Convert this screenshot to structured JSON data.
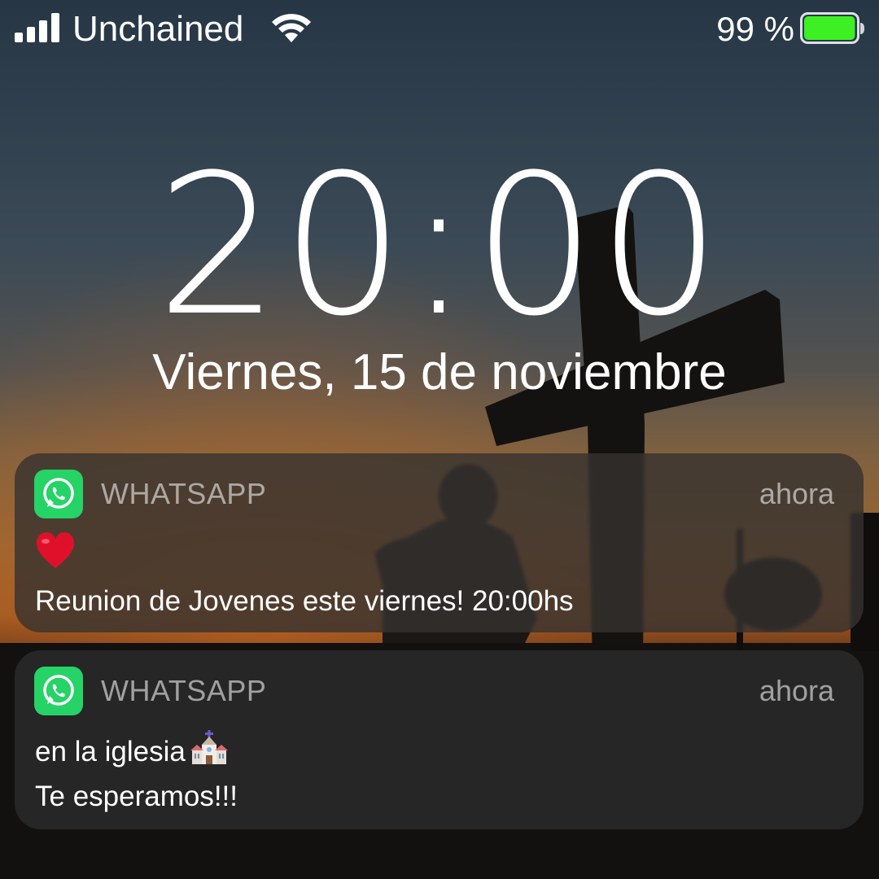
{
  "status_bar": {
    "carrier": "Unchained",
    "battery_percent": "99 %",
    "battery_level": 0.99,
    "battery_color": "#3df024"
  },
  "lock_screen": {
    "time": "20:00",
    "date": "Viernes, 15 de noviembre"
  },
  "notifications": [
    {
      "app": "WHATSAPP",
      "time": "ahora",
      "icon": "whatsapp-icon",
      "lines": [
        "❤️",
        "Reunion de Jovenes este viernes! 20:00hs"
      ]
    },
    {
      "app": "WHATSAPP",
      "time": "ahora",
      "icon": "whatsapp-icon",
      "lines": [
        "en la iglesia",
        "Te esperamos!!!"
      ]
    }
  ],
  "colors": {
    "whatsapp_green": "#25d366",
    "sky_top": "#2a3848",
    "sunset_orange": "#b56a2c"
  }
}
